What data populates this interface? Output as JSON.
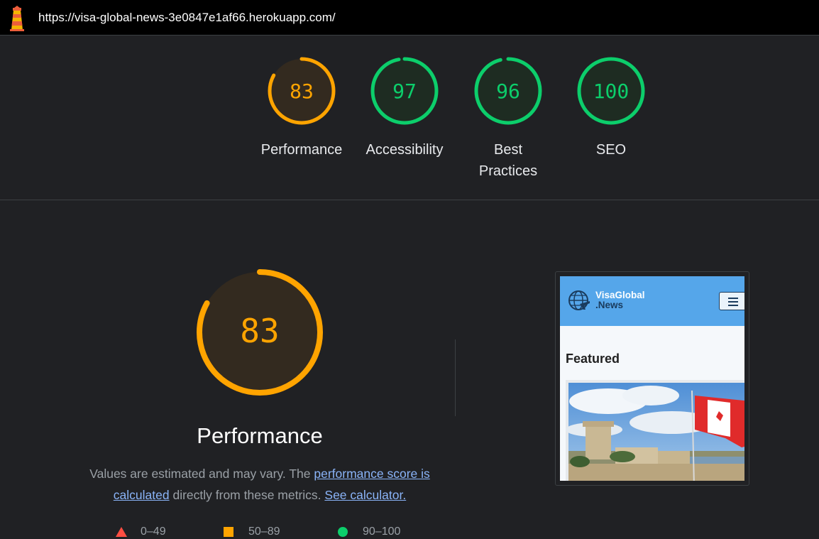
{
  "url_bar": {
    "url": "https://visa-global-news-3e0847e1af66.herokuapp.com/"
  },
  "summary": [
    {
      "score": "83",
      "label": "Performance",
      "color": "#ffa400",
      "fraction": 0.83
    },
    {
      "score": "97",
      "label": "Accessibility",
      "color": "#0cce6b",
      "fraction": 0.97
    },
    {
      "score": "96",
      "label": "Best Practices",
      "color": "#0cce6b",
      "fraction": 0.96
    },
    {
      "score": "100",
      "label": "SEO",
      "color": "#0cce6b",
      "fraction": 1.0
    }
  ],
  "performance": {
    "score": "83",
    "title": "Performance",
    "desc_1": "Values are estimated and may vary. The ",
    "link_1": "performance score is calculated",
    "desc_2": " directly from these metrics. ",
    "link_2": "See calculator."
  },
  "legend": {
    "fail": "0–49",
    "average": "50–89",
    "pass": "90–100"
  },
  "thumbnail": {
    "brand_line1": "VisaGlobal",
    "brand_line2": ".News",
    "featured": "Featured"
  }
}
